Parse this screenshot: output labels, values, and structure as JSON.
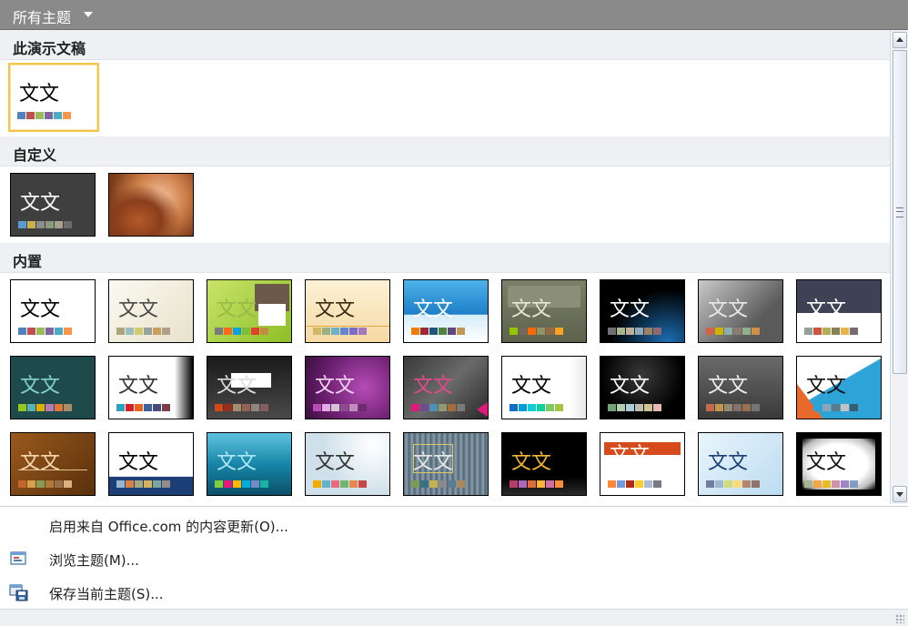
{
  "header": {
    "title": "所有主题"
  },
  "sections": [
    {
      "label": "此演示文稿"
    },
    {
      "label": "自定义"
    },
    {
      "label": "内置"
    }
  ],
  "thumb_text": "文文",
  "colors": {
    "accent_selected": "#f3c54b",
    "header_bg": "#8a8a8a",
    "section_bg": "#eef0f3"
  },
  "menu": {
    "items": [
      {
        "label": "启用来自 Office.com 的内容更新(O)...",
        "icon": "none"
      },
      {
        "label": "浏览主题(M)...",
        "icon": "browse-folder-icon"
      },
      {
        "label": "保存当前主题(S)...",
        "icon": "save-theme-icon"
      }
    ]
  }
}
